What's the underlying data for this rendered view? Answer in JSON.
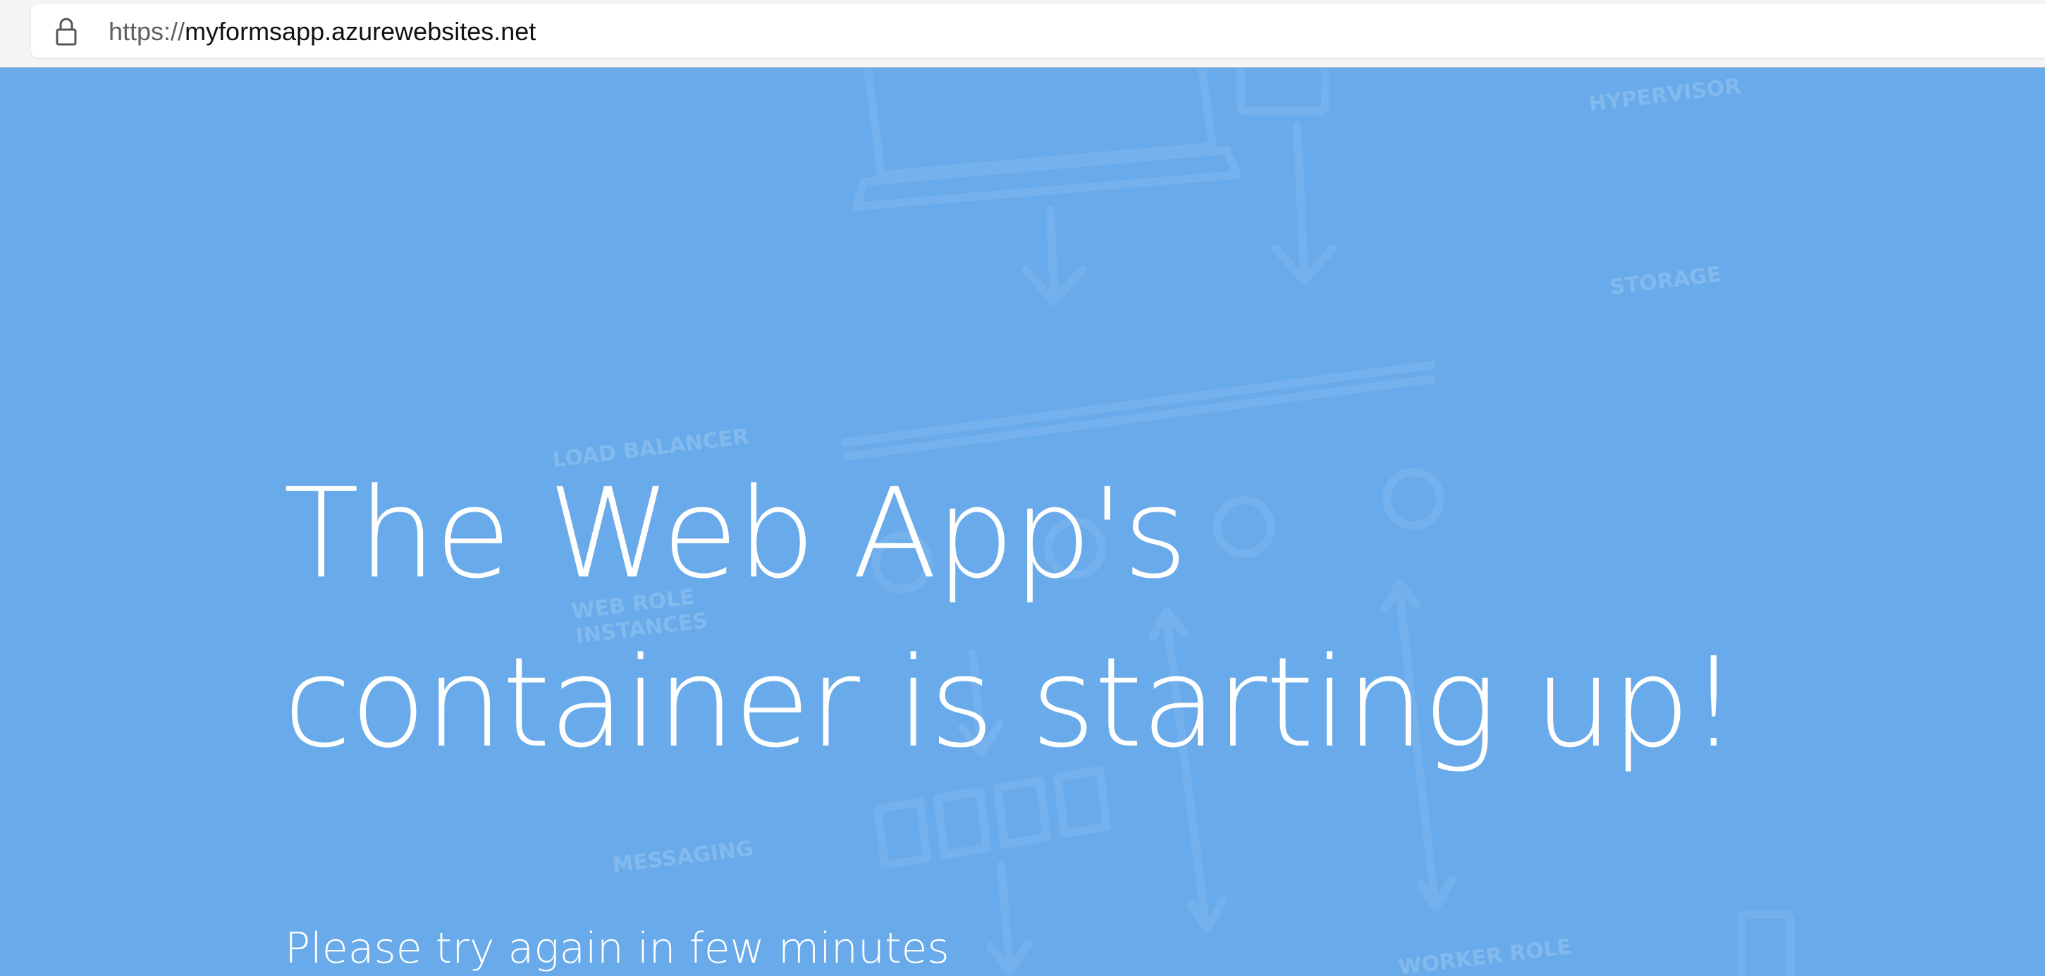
{
  "browser": {
    "url_scheme": "https://",
    "url_host": "myformsapp.azurewebsites.net",
    "lock_icon": "lock-icon"
  },
  "page": {
    "headline": "The Web App's container is starting up!",
    "message": "Please try again in few minutes",
    "background_color": "#68aaea",
    "text_color": "#ffffff"
  },
  "watermark": {
    "labels": [
      "LOAD BALANCER",
      "WEB ROLE",
      "INSTANCES",
      "MESSAGING",
      "HYPERVISOR",
      "STORAGE",
      "WORKER ROLE"
    ]
  }
}
